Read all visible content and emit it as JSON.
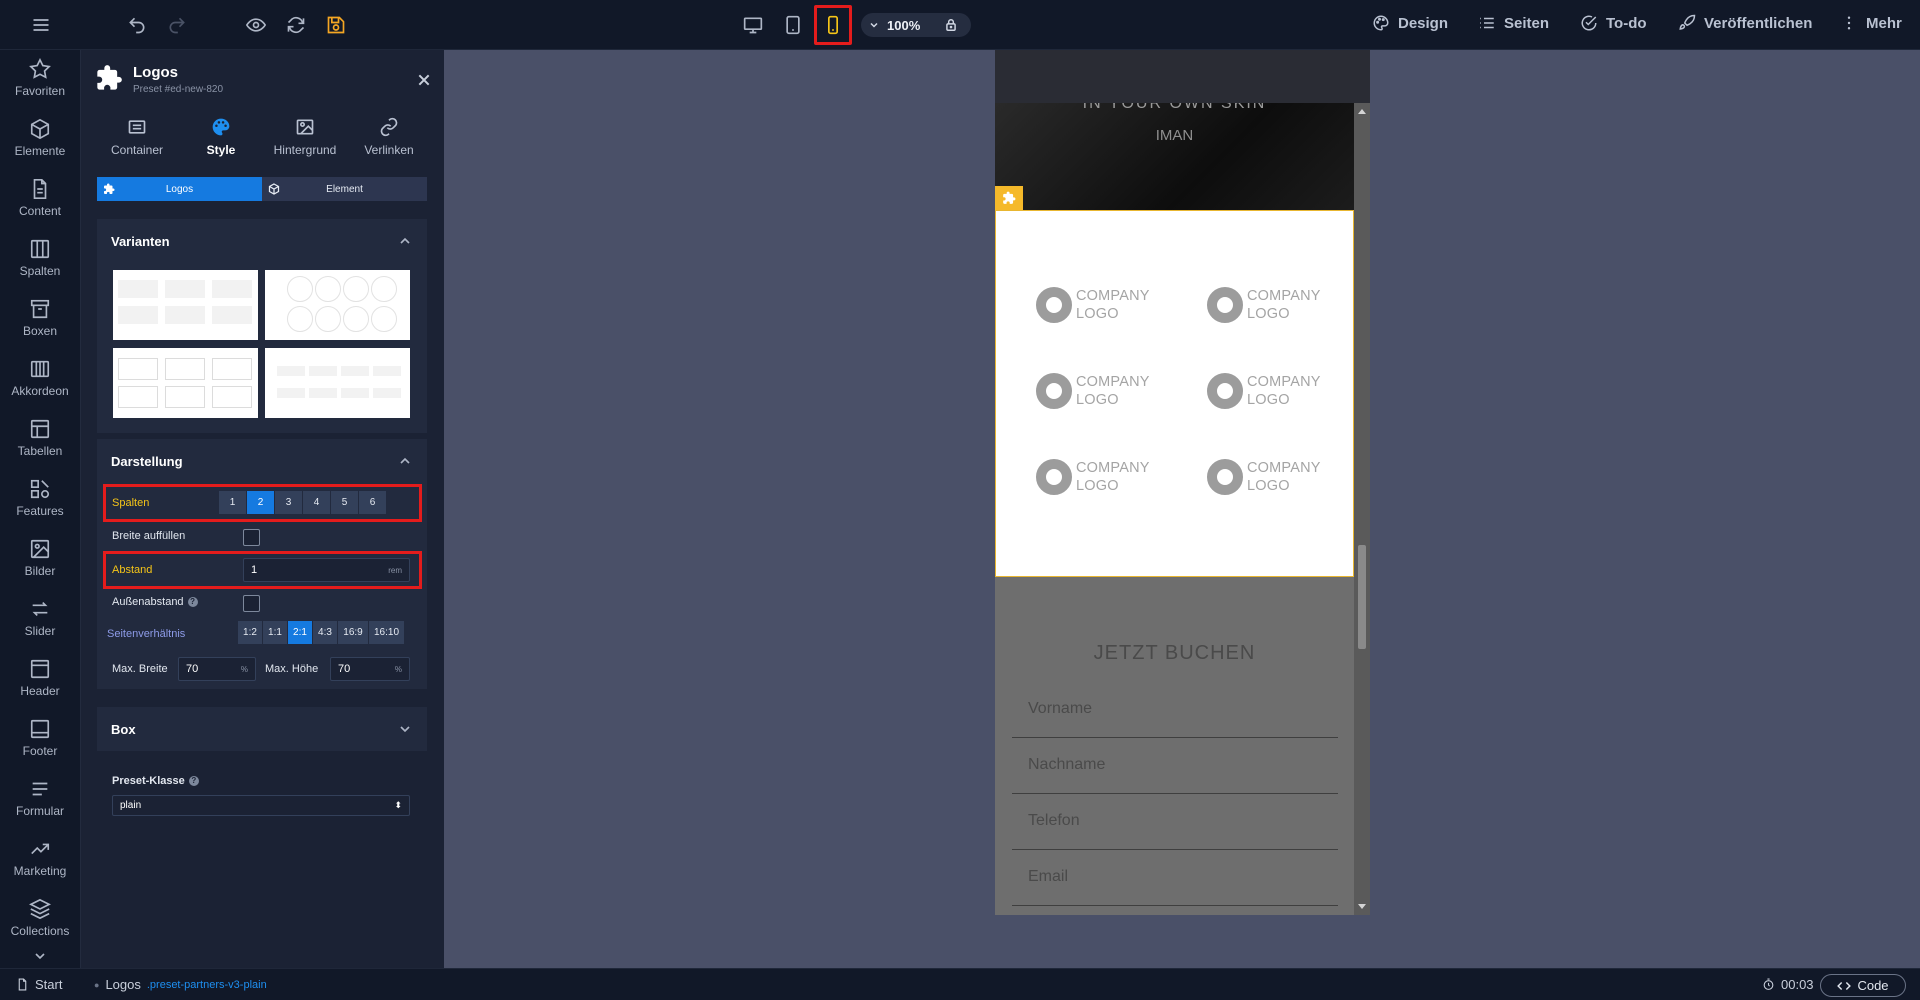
{
  "topbar": {
    "zoom": "100%",
    "right_actions": [
      {
        "label": "Design",
        "icon": "palette-icon"
      },
      {
        "label": "Seiten",
        "icon": "list-icon"
      },
      {
        "label": "To-do",
        "icon": "check-circle-icon"
      },
      {
        "label": "Veröffentlichen",
        "icon": "rocket-icon"
      },
      {
        "label": "Mehr",
        "icon": "more-vertical-icon"
      }
    ],
    "active_device": "mobile"
  },
  "iconbar": {
    "items": [
      "Favoriten",
      "Elemente",
      "Content",
      "Spalten",
      "Boxen",
      "Akkordeon",
      "Tabellen",
      "Features",
      "Bilder",
      "Slider",
      "Header",
      "Footer",
      "Formular",
      "Marketing",
      "Collections"
    ]
  },
  "panel": {
    "title": "Logos",
    "subtitle": "Preset #ed-new-820",
    "tabs": [
      {
        "label": "Container",
        "icon": "container-icon"
      },
      {
        "label": "Style",
        "icon": "palette-icon"
      },
      {
        "label": "Hintergrund",
        "icon": "image-icon"
      },
      {
        "label": "Verlinken",
        "icon": "link-icon"
      }
    ],
    "active_tab": "Style",
    "subtabs": [
      "Logos",
      "Element"
    ],
    "active_subtab": "Logos",
    "sections": {
      "varianten": {
        "title": "Varianten"
      },
      "darstellung": {
        "title": "Darstellung",
        "spalten_label": "Spalten",
        "spalten_options": [
          "1",
          "2",
          "3",
          "4",
          "5",
          "6"
        ],
        "spalten_selected": "2",
        "breite_label": "Breite auffüllen",
        "abstand_label": "Abstand",
        "abstand_value": "1",
        "abstand_unit": "rem",
        "aussenabstand_label": "Außenabstand",
        "seitenverhaeltnis_label": "Seitenverhältnis",
        "ratio_options": [
          "1:2",
          "1:1",
          "2:1",
          "4:3",
          "16:9",
          "16:10"
        ],
        "ratio_selected": "2:1",
        "max_breite_label": "Max. Breite",
        "max_breite_value": "70",
        "max_hoehe_label": "Max. Höhe",
        "max_hoehe_value": "70",
        "percent_unit": "%"
      },
      "box": {
        "title": "Box"
      },
      "preset": {
        "label": "Preset-Klasse",
        "value": "plain"
      }
    }
  },
  "preview": {
    "hero_line1": "IN YOUR OWN SKIN",
    "hero_line2": "IMAN",
    "logo_text_1": "COMPANY",
    "logo_text_2": "LOGO",
    "booking_title": "JETZT BUCHEN",
    "form_fields": [
      "Vorname",
      "Nachname",
      "Telefon",
      "Email"
    ]
  },
  "statusbar": {
    "start": "Start",
    "crumb": "Logos",
    "crumb_class": ".preset-partners-v3-plain",
    "time": "00:03",
    "code": "Code"
  }
}
